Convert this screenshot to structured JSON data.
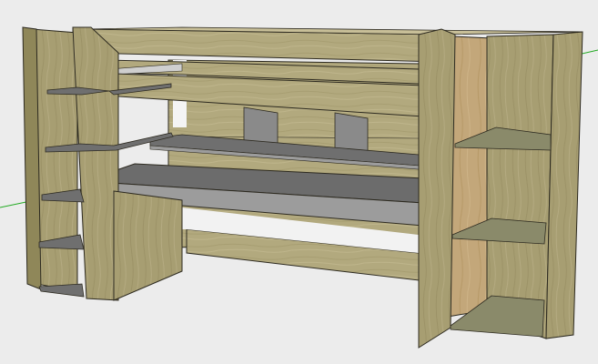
{
  "app": {
    "type": "3d-modeling-viewport",
    "background_color": "#ececec"
  },
  "scene": {
    "model": "loft-bed-with-desk-and-shelves",
    "style": "wood-textured",
    "colors": {
      "wood_light": "#b7ae86",
      "wood_mid": "#a39a6f",
      "wood_dark": "#8f8759",
      "wood_side": "#c0b48f",
      "shelf_top": "#6f6f6f",
      "shelf_front": "#9c9c9c",
      "edge": "#2d2a20",
      "axis_green": "#22aa22"
    },
    "axes": [
      "green-axis"
    ]
  }
}
